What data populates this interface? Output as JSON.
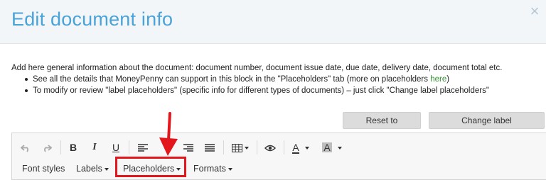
{
  "dialog": {
    "title": "Edit document info",
    "close_glyph": "×"
  },
  "intro": {
    "text": "Add here general information about the document: document number, document issue date, due date, delivery date, document total etc.",
    "bullet1_prefix": "See all the details that MoneyPenny can support in this block in the \"Placeholders\" tab (more on placeholders ",
    "bullet1_link": "here",
    "bullet1_suffix": ")",
    "bullet2": "To modify or review \"label placeholders\" (specific info for different types of documents) – just click \"Change label placeholders\""
  },
  "buttons": {
    "reset": "Reset to defaults",
    "change_labels": "Change label placeholders"
  },
  "toolbar": {
    "undo_icon": "undo-icon",
    "redo_icon": "redo-icon",
    "bold": "B",
    "italic": "I",
    "underline": "U",
    "font_color_letter": "A",
    "bg_color_letter": "A"
  },
  "menus": {
    "font_styles": "Font styles",
    "labels": "Labels",
    "placeholders": "Placeholders",
    "formats": "Formats"
  },
  "colors": {
    "title": "#4aa3d8",
    "link": "#2f8f2f",
    "highlight": "#e3161b"
  }
}
